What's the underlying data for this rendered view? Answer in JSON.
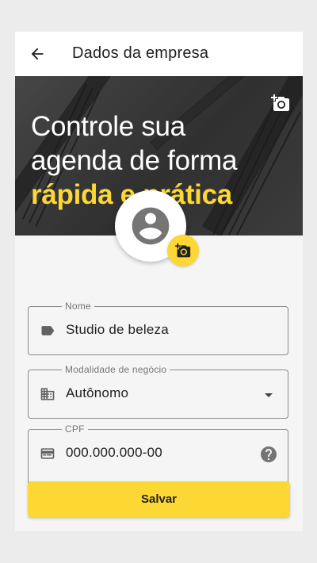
{
  "app_bar": {
    "title": "Dados da empresa",
    "back_icon": "arrow-back-icon"
  },
  "banner": {
    "line1": "Controle sua",
    "line2": "agenda de forma",
    "line3": "rápida e prática",
    "camera_icon": "add-photo-icon",
    "background": "salon combs and scissors photo"
  },
  "avatar": {
    "icon": "account-circle-icon",
    "camera_icon": "add-photo-icon"
  },
  "form": {
    "name": {
      "label": "Nome",
      "value": "Studio de beleza",
      "icon": "label-tag-icon"
    },
    "business_type": {
      "label": "Modalidade de negócio",
      "value": "Autônomo",
      "icon": "business-building-icon",
      "trailing_icon": "dropdown-arrow-icon"
    },
    "cpf": {
      "label": "CPF",
      "value": "000.000.000-00",
      "icon": "id-card-icon",
      "trailing_icon": "help-icon"
    }
  },
  "save_button": {
    "label": "Salvar"
  },
  "colors": {
    "accent": "#fdd835",
    "banner_bg": "#4a4a4a",
    "text": "#212121",
    "muted": "#757575"
  }
}
